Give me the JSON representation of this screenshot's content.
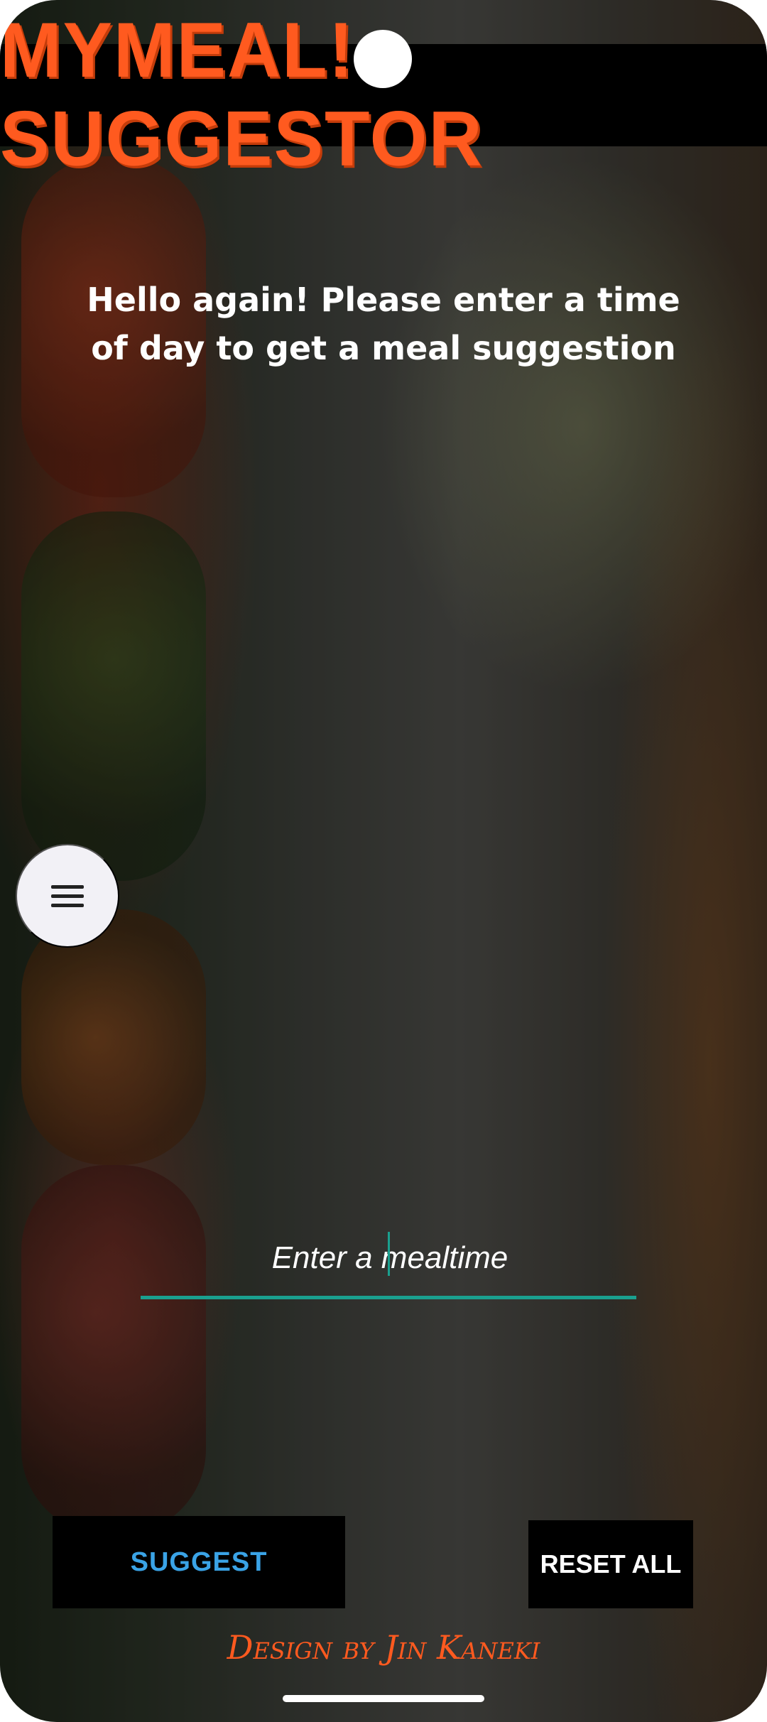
{
  "app": {
    "title": "MYMEAL! SUGGESTOR"
  },
  "prompt": {
    "text": "Hello again! Please enter a time of day to get a meal suggestion"
  },
  "meal_input": {
    "placeholder": "Enter a mealtime",
    "value": ""
  },
  "menu_button": {
    "icon": "hamburger-menu-icon"
  },
  "buttons": {
    "suggest_label": "SUGGEST",
    "reset_label": "RESET ALL"
  },
  "footer": {
    "credit": "Design by Jin Kaneki"
  },
  "colors": {
    "title_orange": "#ff5a1f",
    "accent_teal": "#1aa08f",
    "suggest_blue": "#3aa3e6",
    "header_bg": "#000000"
  }
}
